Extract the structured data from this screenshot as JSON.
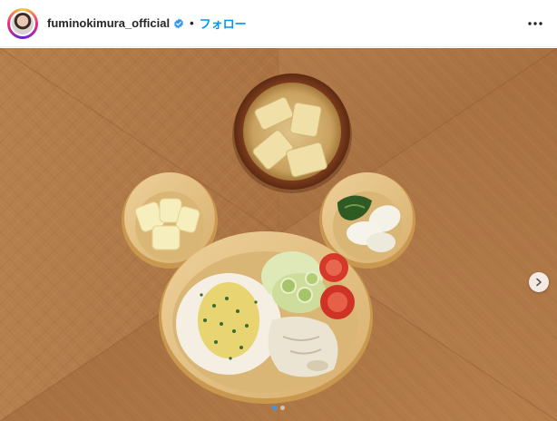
{
  "header": {
    "username": "fuminokimura_official",
    "separator": "•",
    "follow_label": "フォロー",
    "verified_icon": "verified-badge-icon",
    "more_icon": "more-options-icon"
  },
  "media": {
    "description_icon": "food-photo",
    "carousel_total": 2,
    "carousel_current": 1
  },
  "colors": {
    "accent": "#0095f6",
    "verified": "#3897f0"
  }
}
